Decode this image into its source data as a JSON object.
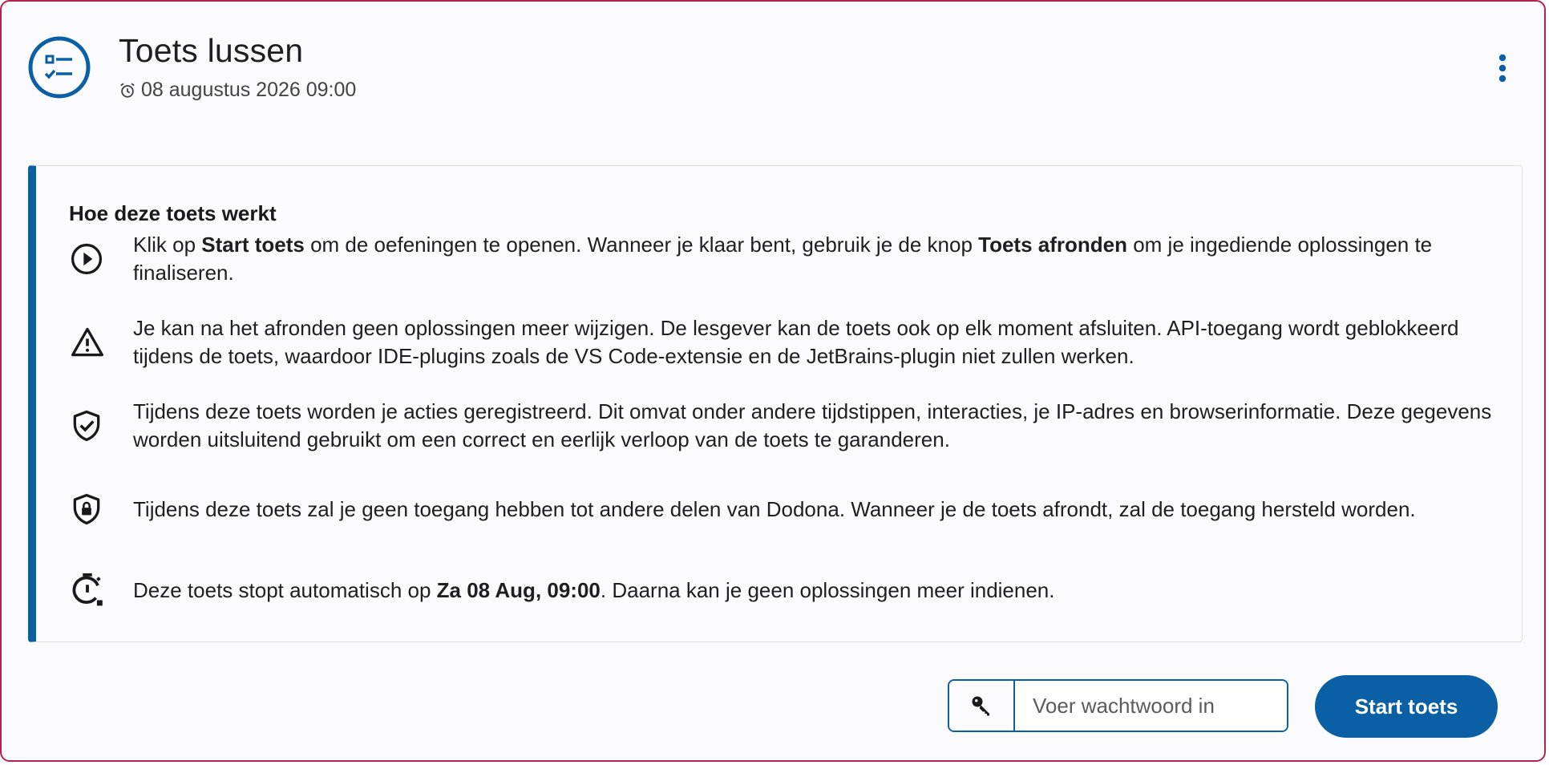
{
  "header": {
    "title": "Toets lussen",
    "date": "08 augustus 2026 09:00",
    "icon": "checklist-icon",
    "menu_icon": "more-vertical-icon"
  },
  "info": {
    "title": "Hoe deze toets werkt",
    "rows": [
      {
        "icon": "play-circle-icon",
        "parts": [
          "Klik op ",
          "Start toets",
          " om de oefeningen te openen. Wanneer je klaar bent, gebruik je de knop ",
          "Toets afronden",
          " om je ingediende oplossingen te finaliseren."
        ]
      },
      {
        "icon": "warning-icon",
        "text": "Je kan na het afronden geen oplossingen meer wijzigen. De lesgever kan de toets ook op elk moment afsluiten. API-toegang wordt geblokkeerd tijdens de toets, waardoor IDE-plugins zoals de VS Code-extensie en de JetBrains-plugin niet zullen werken."
      },
      {
        "icon": "shield-check-icon",
        "text": "Tijdens deze toets worden je acties geregistreerd. Dit omvat onder andere tijdstippen, interacties, je IP-adres en browserinformatie. Deze gegevens worden uitsluitend gebruikt om een correct en eerlijk verloop van de toets te garanderen."
      },
      {
        "icon": "shield-lock-icon",
        "text": "Tijdens deze toets zal je geen toegang hebben tot andere delen van Dodona. Wanneer je de toets afrondt, zal de toegang hersteld worden."
      },
      {
        "icon": "timer-alert-icon",
        "parts": [
          "Deze toets stopt automatisch op ",
          "Za 08 Aug, 09:00",
          ". Daarna kan je geen oplossingen meer indienen."
        ]
      }
    ]
  },
  "password": {
    "placeholder": "Voer wachtwoord in",
    "value": "",
    "icon": "key-icon"
  },
  "start_button": {
    "label": "Start toets"
  },
  "colors": {
    "accent": "#0b5fa5",
    "card_border": "#b3234f"
  }
}
